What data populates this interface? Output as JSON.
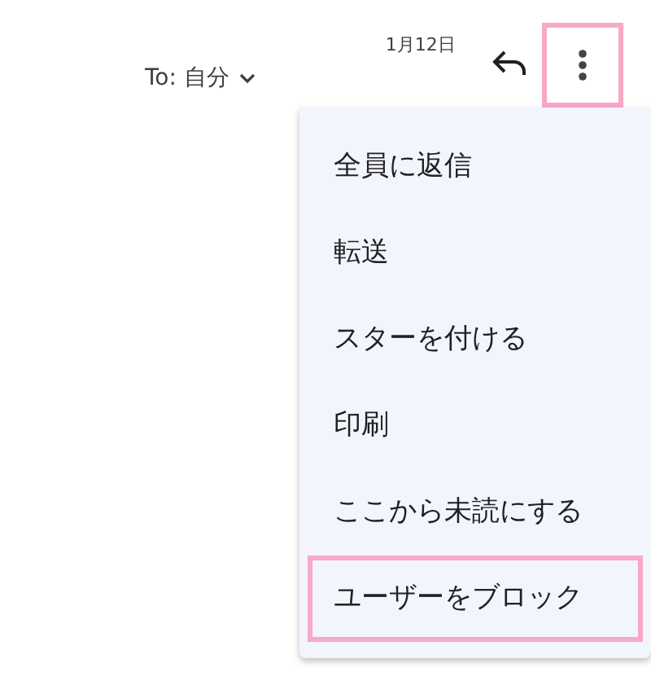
{
  "header": {
    "date": "1月12日",
    "recipient": "To: 自分",
    "more_button_highlighted": true
  },
  "menu": {
    "items": [
      {
        "label": "全員に返信",
        "highlighted": false
      },
      {
        "label": "転送",
        "highlighted": false
      },
      {
        "label": "スターを付ける",
        "highlighted": false
      },
      {
        "label": "印刷",
        "highlighted": false
      },
      {
        "label": "ここから未読にする",
        "highlighted": false
      },
      {
        "label": "ユーザーをブロック",
        "highlighted": true
      }
    ]
  }
}
